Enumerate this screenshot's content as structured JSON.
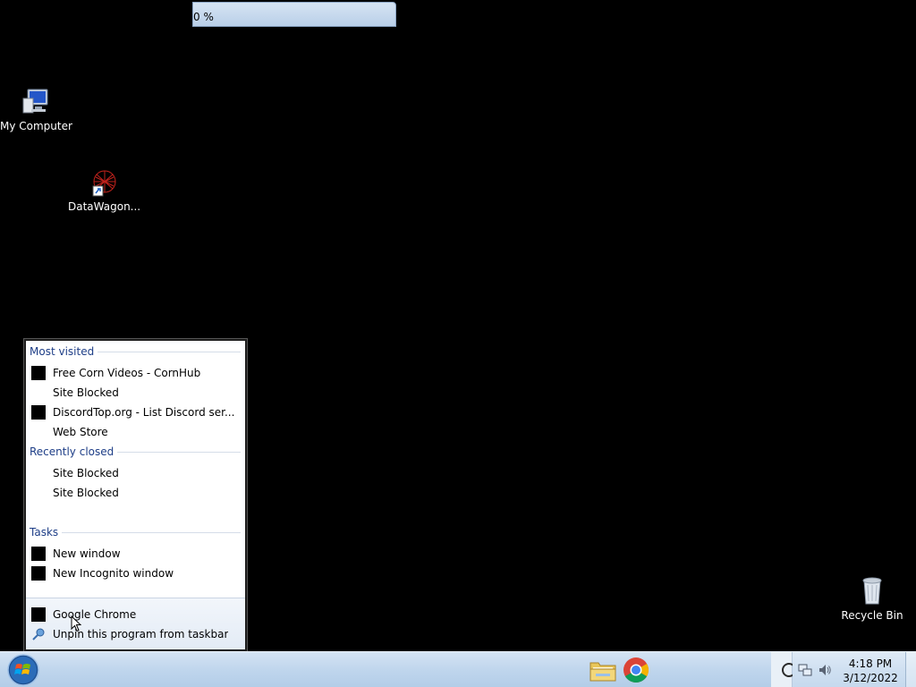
{
  "progress": {
    "text": "0 %",
    "fraction": 0
  },
  "desktop": {
    "icons": [
      {
        "label": "My Computer",
        "icon": "my-computer-icon"
      },
      {
        "label": "DataWagon...",
        "icon": "datawagon-shortcut-icon"
      },
      {
        "label": "Recycle Bin",
        "icon": "recycle-bin-icon"
      }
    ]
  },
  "jumplist": {
    "most_visited_header": "Most visited",
    "most_visited": [
      {
        "label": "Free Corn Videos - CornHub",
        "has_icon": true
      },
      {
        "label": "Site Blocked",
        "has_icon": false
      },
      {
        "label": "DiscordTop.org - List Discord ser...",
        "has_icon": true
      },
      {
        "label": "Web Store",
        "has_icon": false
      }
    ],
    "recently_closed_header": "Recently closed",
    "recently_closed": [
      {
        "label": "Site Blocked"
      },
      {
        "label": "Site Blocked"
      }
    ],
    "tasks_header": "Tasks",
    "tasks": [
      {
        "label": "New window"
      },
      {
        "label": "New Incognito window"
      }
    ],
    "footer": [
      {
        "label": "Google Chrome",
        "icon": "chrome-icon"
      },
      {
        "label": "Unpin this program from taskbar",
        "icon": "pin-icon"
      }
    ]
  },
  "taskbar": {
    "apps": [
      {
        "name": "Windows Explorer",
        "icon": "folder-icon"
      },
      {
        "name": "Google Chrome",
        "icon": "chrome-icon"
      }
    ],
    "clock": {
      "time": "4:18 PM",
      "date": "3/12/2022"
    }
  },
  "colors": {
    "desktop_bg": "#000000",
    "header_blue": "#1e3e87",
    "taskbar": "#c0d6ed"
  }
}
